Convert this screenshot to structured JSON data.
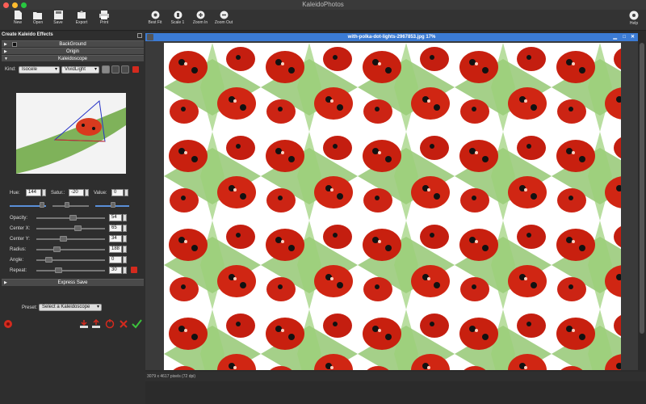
{
  "window": {
    "title": "KaleidoPhotos"
  },
  "toolbar": {
    "new": "New",
    "open": "Open",
    "save": "Save",
    "export": "Export",
    "print": "Print",
    "best_fit": "Best Fit",
    "scale1": "Scale 1",
    "zoom_in": "Zoom In",
    "zoom_out": "Zoom Out",
    "help": "Help"
  },
  "panel": {
    "title": "Create Kaleido Effects",
    "background": "BackGround",
    "origin": "Origin",
    "kaleidoscope": "Kaleidoscope",
    "kind_label": "Kind:",
    "kind_value": "Isocele",
    "blend_value": "VividLight",
    "hue_label": "Hue:",
    "hue_value": "144",
    "satur_label": "Satur.:",
    "satur_value": "-20",
    "value_label": "Value:",
    "value_value": "0",
    "opacity_label": "Opacity:",
    "opacity_value": "54",
    "centerx_label": "Center X:",
    "centerx_value": "65",
    "centery_label": "Center Y:",
    "centery_value": "34",
    "radius_label": "Radius:",
    "radius_value": "188",
    "angle_label": "Angle:",
    "angle_value": "0",
    "repeat_label": "Repeat:",
    "repeat_value": "30",
    "express_save": "Express Save",
    "preset_label": "Preset:",
    "preset_value": "Select a Kaleidoscope"
  },
  "document": {
    "title": "with-polka-dot-lights-2967853.jpg 17%",
    "status": "3079 x 4617 pixels (72 dpi)"
  },
  "colors": {
    "accent": "#3b7bd4",
    "red": "#d42a1e",
    "green": "#3cc23c"
  }
}
